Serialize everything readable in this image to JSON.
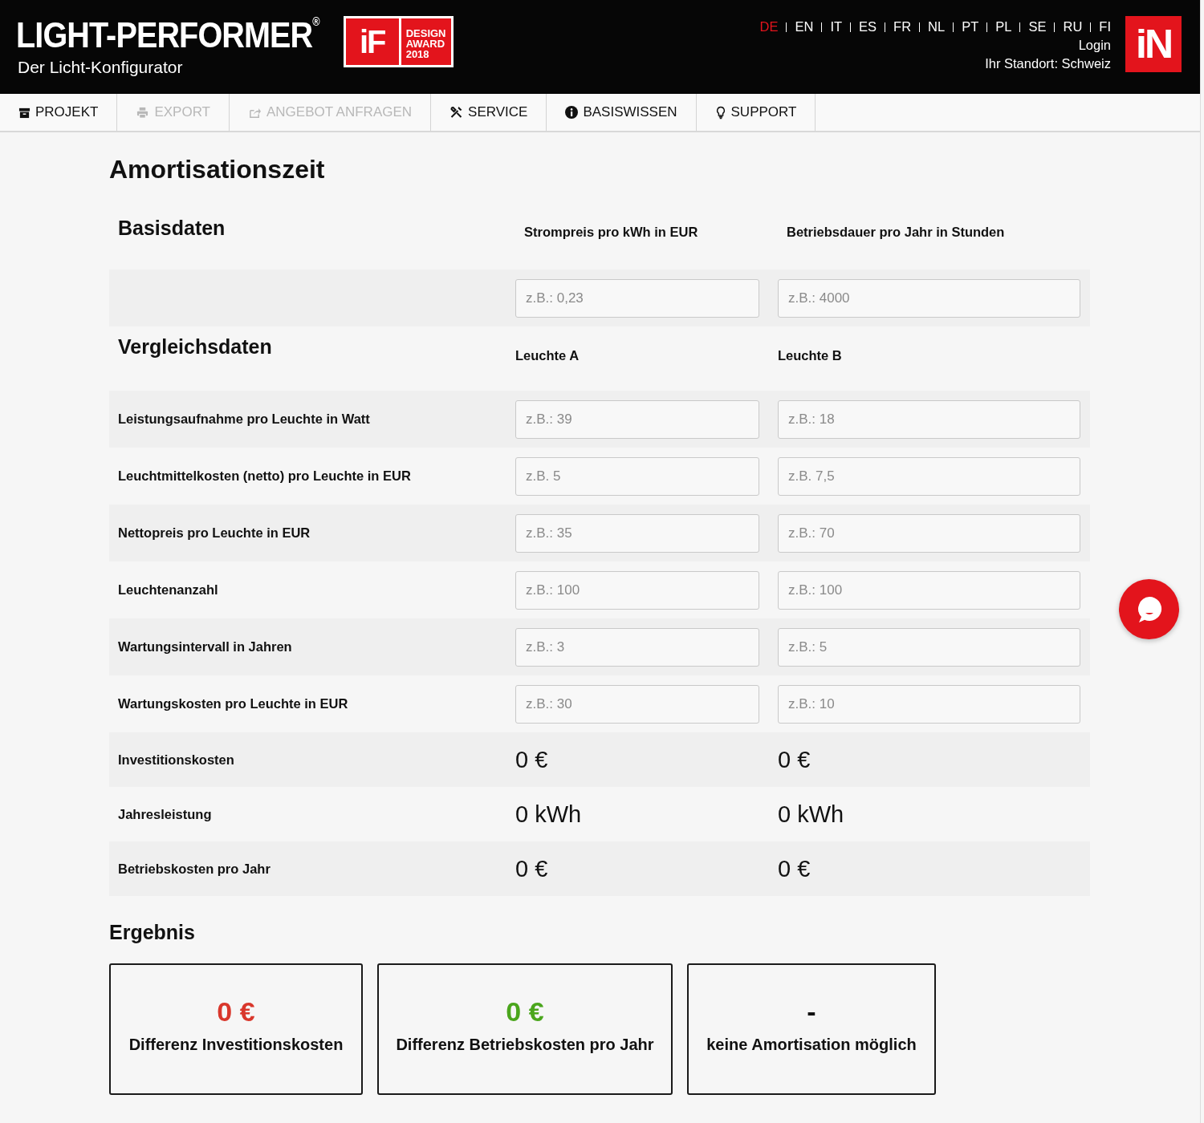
{
  "header": {
    "title": "LIGHT-PERFORMER$^{®}$",
    "subtitle": "Der Licht-Konfigurator",
    "award": {
      "logo": "iF",
      "lines": [
        "DESIGN",
        "AWARD",
        "2018"
      ]
    },
    "languages": [
      {
        "label": "DE",
        "selected": true
      },
      {
        "label": "EN",
        "selected": false
      },
      {
        "label": "IT",
        "selected": false
      },
      {
        "label": "ES",
        "selected": false
      },
      {
        "label": "FR",
        "selected": false
      },
      {
        "label": "NL",
        "selected": false
      },
      {
        "label": "PT",
        "selected": false
      },
      {
        "label": "PL",
        "selected": false
      },
      {
        "label": "SE",
        "selected": false
      },
      {
        "label": "RU",
        "selected": false
      },
      {
        "label": "FI",
        "selected": false
      }
    ],
    "login": "Login",
    "location": "Ihr Standort: Schweiz",
    "brand_logo": "iN"
  },
  "nav": [
    {
      "label": "PROJEKT",
      "disabled": false
    },
    {
      "label": "EXPORT",
      "disabled": true
    },
    {
      "label": "ANGEBOT ANFRAGEN",
      "disabled": true
    },
    {
      "label": "SERVICE",
      "disabled": false
    },
    {
      "label": "BASISWISSEN",
      "disabled": false
    },
    {
      "label": "SUPPORT",
      "disabled": false
    }
  ],
  "title": "Amortisationszeit",
  "basis": {
    "heading": "Basisdaten",
    "columns": [
      "Strompreis pro kWh in EUR",
      "Betriebsdauer pro Jahr in Stunden"
    ],
    "placeholders": [
      "z.B.: 0,23",
      "z.B.: 4000"
    ]
  },
  "comparison": {
    "heading": "Vergleichsdaten",
    "columns": [
      "Leuchte A",
      "Leuchte B"
    ],
    "rows": [
      {
        "label": "Leistungsaufnahme pro Leuchte in Watt",
        "kind": "input",
        "placeholders": [
          "z.B.: 39",
          "z.B.: 18"
        ]
      },
      {
        "label": "Leuchtmittelkosten (netto) pro Leuchte in EUR",
        "kind": "input",
        "placeholders": [
          "z.B. 5",
          "z.B. 7,5"
        ]
      },
      {
        "label": "Nettopreis pro Leuchte in EUR",
        "kind": "input",
        "placeholders": [
          "z.B.: 35",
          "z.B.: 70"
        ]
      },
      {
        "label": "Leuchtenanzahl",
        "kind": "input",
        "placeholders": [
          "z.B.: 100",
          "z.B.: 100"
        ]
      },
      {
        "label": "Wartungsintervall in Jahren",
        "kind": "input",
        "placeholders": [
          "z.B.: 3",
          "z.B.: 5"
        ]
      },
      {
        "label": "Wartungskosten pro Leuchte in EUR",
        "kind": "input",
        "placeholders": [
          "z.B.: 30",
          "z.B.: 10"
        ]
      },
      {
        "label": "Investitionskosten",
        "kind": "value",
        "values": [
          "0 €",
          "0 €"
        ]
      },
      {
        "label": "Jahresleistung",
        "kind": "value",
        "values": [
          "0 kWh",
          "0 kWh"
        ]
      },
      {
        "label": "Betriebskosten pro Jahr",
        "kind": "value",
        "values": [
          "0 €",
          "0 €"
        ]
      }
    ]
  },
  "results": {
    "heading": "Ergebnis",
    "cards": [
      {
        "value": "0 €",
        "color": "#d9372c",
        "label": "Differenz Investitionskosten"
      },
      {
        "value": "0 €",
        "color": "#4ba61d",
        "label": "Differenz Betriebskosten pro Jahr"
      },
      {
        "value": "-",
        "color": "#111111",
        "label": "keine Amortisation möglich"
      }
    ]
  }
}
